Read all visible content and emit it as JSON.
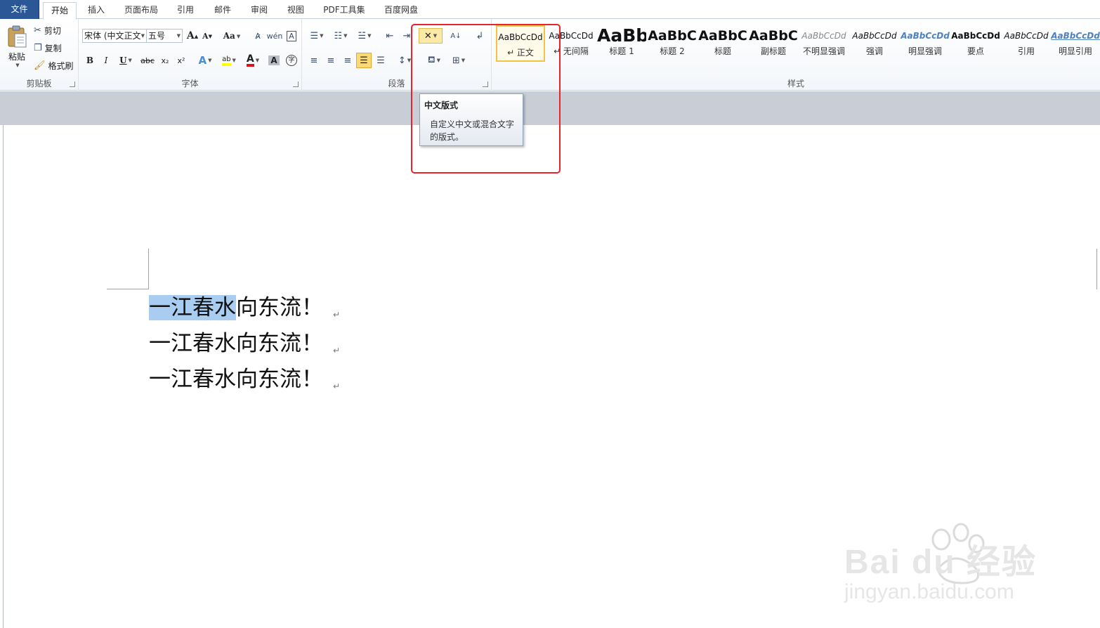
{
  "tabs": {
    "file": "文件",
    "home": "开始",
    "insert": "插入",
    "layout": "页面布局",
    "references": "引用",
    "mailings": "邮件",
    "review": "审阅",
    "view": "视图",
    "pdf": "PDF工具集",
    "baidu": "百度网盘"
  },
  "clipboard": {
    "paste": "粘贴",
    "cut": "剪切",
    "copy": "复制",
    "format_painter": "格式刷",
    "label": "剪贴板"
  },
  "font": {
    "family": "宋体 (中文正文",
    "size": "五号",
    "label": "字体",
    "grow": "A",
    "shrink": "A",
    "change_case": "Aa",
    "bold": "B",
    "italic": "I",
    "underline": "U",
    "strike": "abc",
    "subscript": "x₂",
    "superscript": "x²",
    "highlight_color": "#ffff00",
    "font_color": "#e01010"
  },
  "paragraph": {
    "label": "段落"
  },
  "styles": {
    "label": "样式",
    "items": [
      {
        "sample": "AaBbCcDd",
        "name": "↵ 正文"
      },
      {
        "sample": "AaBbCcDd",
        "name": "↵ 无间隔"
      },
      {
        "sample": "AaBb",
        "name": "标题 1"
      },
      {
        "sample": "AaBbC",
        "name": "标题 2"
      },
      {
        "sample": "AaBbC",
        "name": "标题"
      },
      {
        "sample": "AaBbC",
        "name": "副标题"
      },
      {
        "sample": "AaBbCcDd",
        "name": "不明显强调"
      },
      {
        "sample": "AaBbCcDd",
        "name": "强调"
      },
      {
        "sample": "AaBbCcDd",
        "name": "明显强调"
      },
      {
        "sample": "AaBbCcDd",
        "name": "要点"
      },
      {
        "sample": "AaBbCcDd",
        "name": "引用"
      },
      {
        "sample": "AaBbCcDd",
        "name": "明显引用"
      }
    ]
  },
  "tooltip": {
    "title": "中文版式",
    "desc_line1": "自定义中文或混合文字",
    "desc_line2": "的版式。"
  },
  "document": {
    "line1_selected": "一江春水",
    "line1_rest": "向东流！",
    "line2": "一江春水向东流！",
    "line3": "一江春水向东流！",
    "para_mark": "↵"
  },
  "watermark": {
    "brand": "Bai du 经验",
    "url": "jingyan.baidu.com"
  },
  "colors": {
    "file_tab": "#2b5797",
    "selection": "#a9cdf1",
    "annotation_red": "#e8232b",
    "style_selected_border": "#f5c242"
  }
}
